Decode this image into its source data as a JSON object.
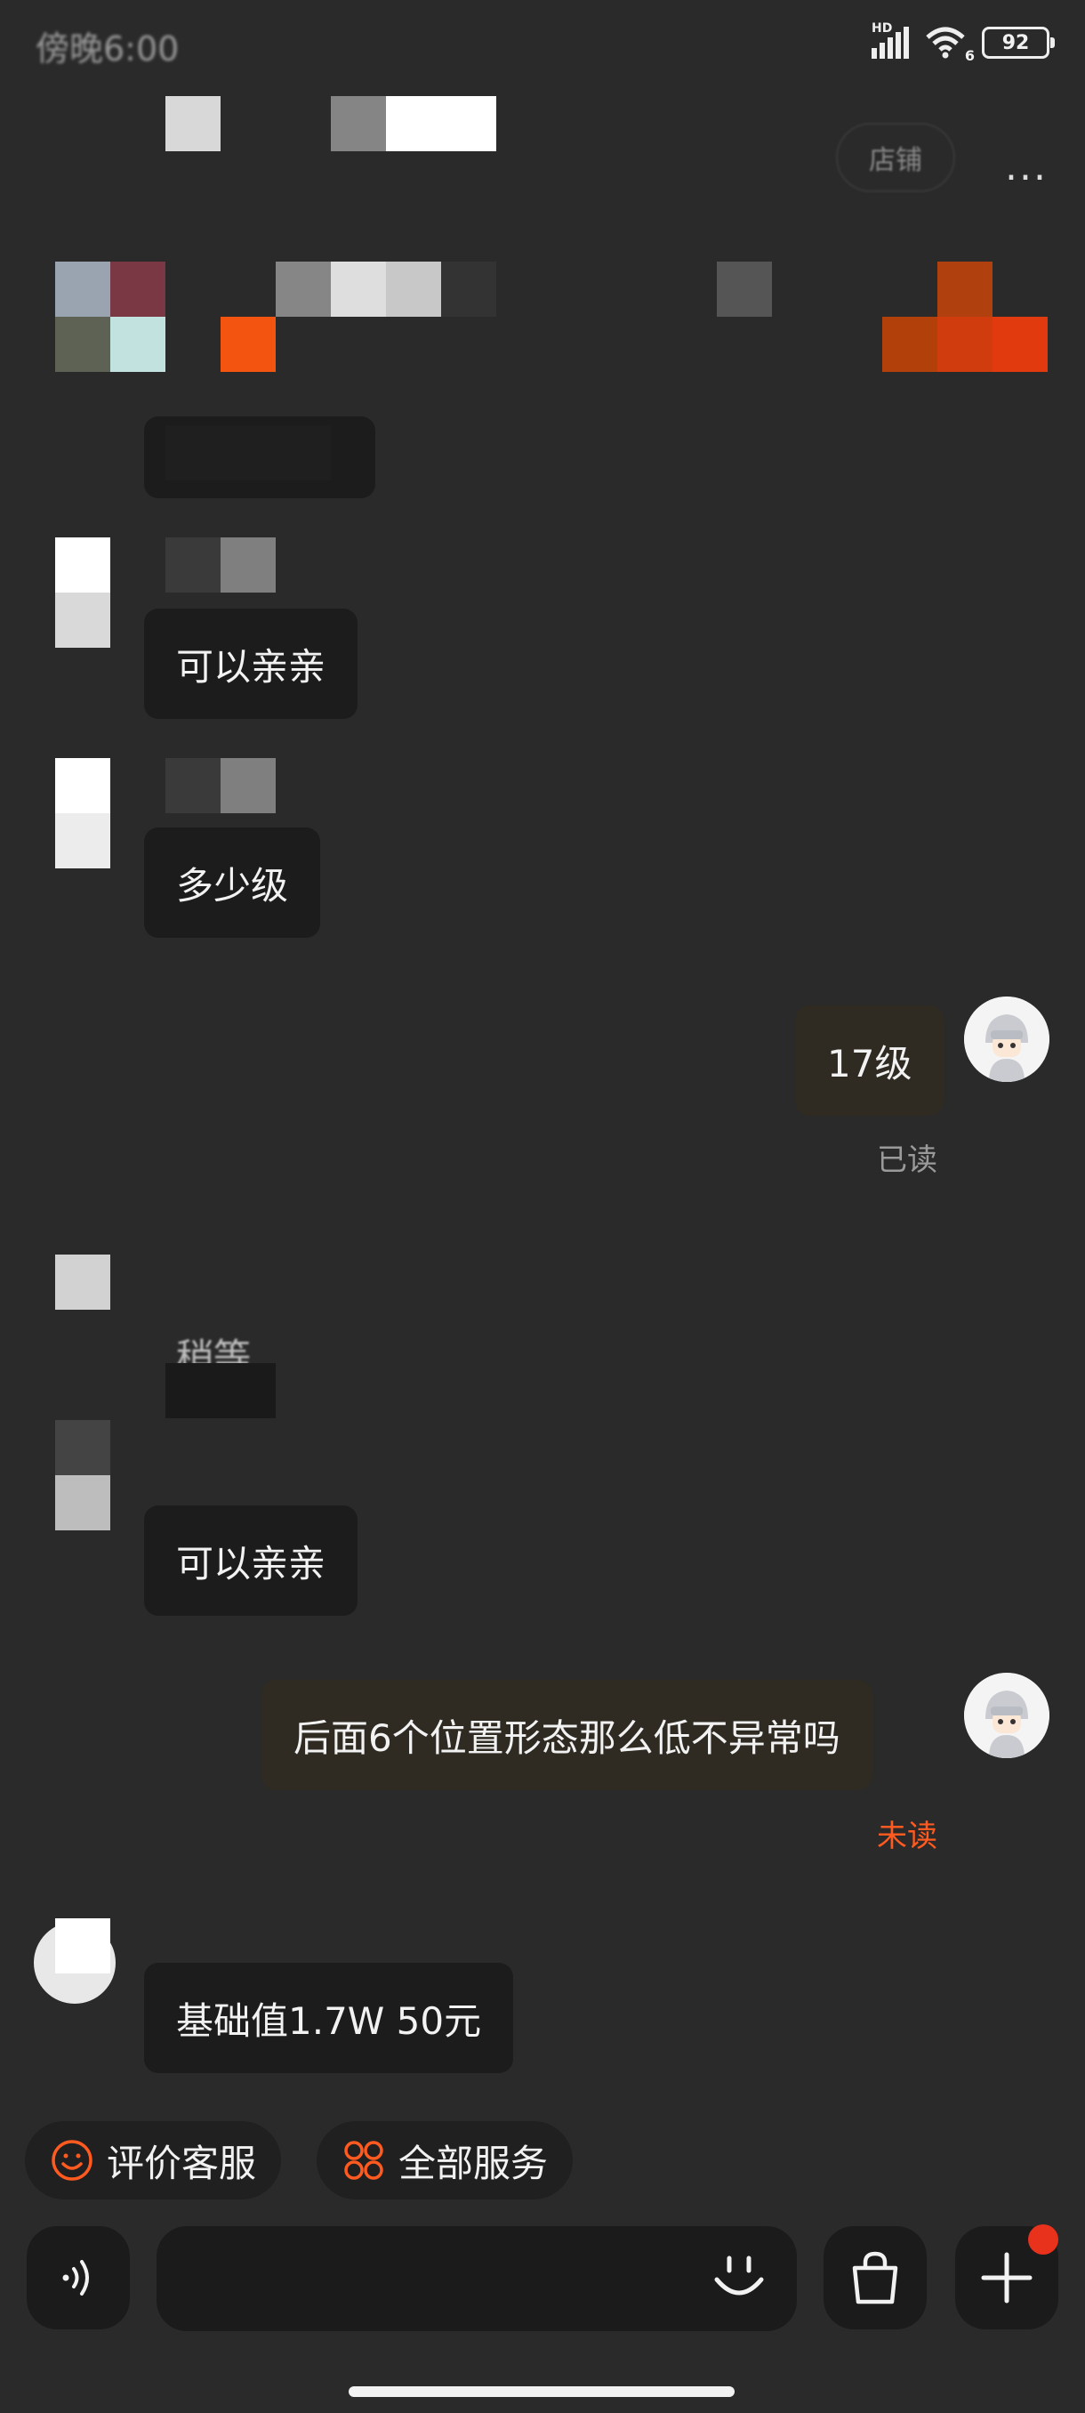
{
  "status_bar": {
    "time": "傍晚6:00",
    "signal_label": "HD",
    "wifi_label": "6",
    "battery": "92"
  },
  "header": {
    "shop_label": "店铺",
    "more_label": "..."
  },
  "messages": [
    {
      "direction": "in",
      "text": "稍等"
    },
    {
      "direction": "in",
      "text": "可以亲亲"
    },
    {
      "direction": "in",
      "text": "多少级"
    },
    {
      "direction": "out",
      "text": "17级",
      "status": "已读"
    },
    {
      "direction": "in",
      "text": "稍等"
    },
    {
      "direction": "in",
      "text": "可以亲亲"
    },
    {
      "direction": "out",
      "text": "后面6个位置形态那么低不异常吗",
      "status": "未读"
    },
    {
      "direction": "in",
      "text": "基础值1.7W  50元"
    }
  ],
  "quick_actions": [
    {
      "label": "评价客服",
      "icon": "smile-circle-icon"
    },
    {
      "label": "全部服务",
      "icon": "service-grid-icon"
    }
  ],
  "input_bar": {
    "voice_icon": "voice-icon",
    "emoji_icon": "emoji-icon",
    "shop_icon": "shopping-bag-icon",
    "plus_icon": "plus-icon"
  },
  "colors": {
    "background": "#2a2a2a",
    "bubble_in": "#1c1c1c",
    "bubble_out": "#2f2a22",
    "accent": "#ff5a1f",
    "notification": "#e8321c"
  }
}
